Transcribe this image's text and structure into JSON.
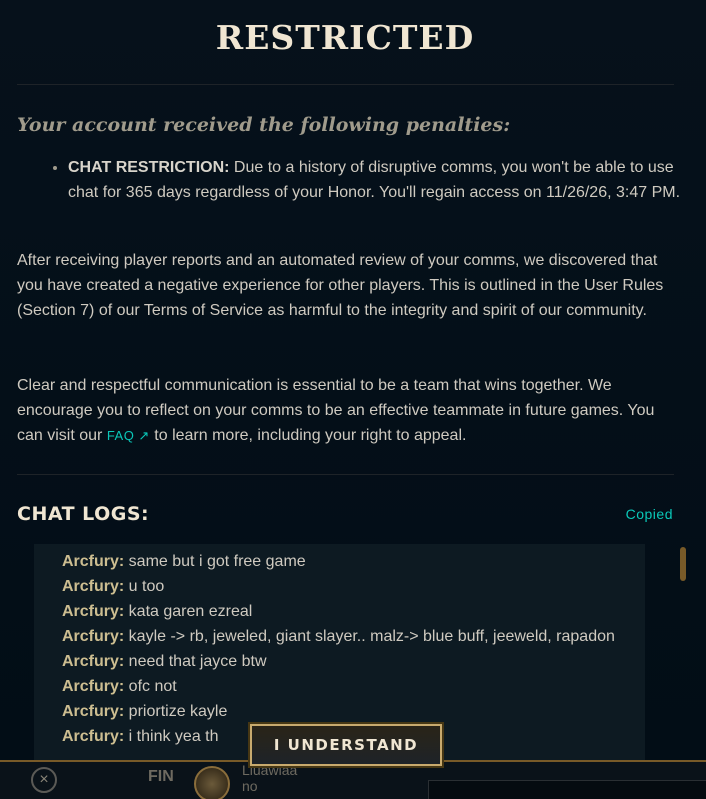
{
  "modal": {
    "title": "RESTRICTED",
    "penalty_heading": "Your account received the following penalties:",
    "penalties": [
      {
        "label": "CHAT RESTRICTION:",
        "text": " Due to a history of disruptive comms, you won't be able to use chat for 365 days regardless of your Honor. You'll regain access on 11/26/26, 3:47 PM."
      }
    ],
    "paragraph1": "After receiving player reports and an automated review of your comms, we discovered that you have created a negative experience for other players. This is outlined in the User Rules (Section 7) of our Terms of Service as harmful to the integrity and spirit of our community.",
    "paragraph2_before": "Clear and respectful communication is essential to be a team that wins together. We encourage you to reflect on your comms to be an effective teammate in future games. You can visit our ",
    "faq_link": "FAQ ↗",
    "paragraph2_after": " to learn more, including your right to appeal.",
    "chat_logs_heading": "CHAT LOGS:",
    "copied_label": "Copied",
    "logs": [
      {
        "user": "Arcfury:",
        "message": " same but i got free game"
      },
      {
        "user": "Arcfury:",
        "message": " u too"
      },
      {
        "user": "Arcfury:",
        "message": " kata garen ezreal"
      },
      {
        "user": "Arcfury:",
        "message": " kayle -> rb, jeweled, giant slayer.. malz-> blue buff, jeeweld, rapadon"
      },
      {
        "user": "Arcfury:",
        "message": " need that jayce btw"
      },
      {
        "user": "Arcfury:",
        "message": " ofc not"
      },
      {
        "user": "Arcfury:",
        "message": " priortize kayle"
      },
      {
        "user": "Arcfury:",
        "message": " i think yea th"
      }
    ],
    "understand_button": "I UNDERSTAND"
  },
  "background": {
    "close_icon": "×",
    "fin_label": "FIN",
    "player_name": "Liuawiaa",
    "player_sub": "no"
  },
  "colors": {
    "accent_gold": "#c8aa6e",
    "link_teal": "#0ac8b9",
    "title": "#f0e6d2"
  }
}
